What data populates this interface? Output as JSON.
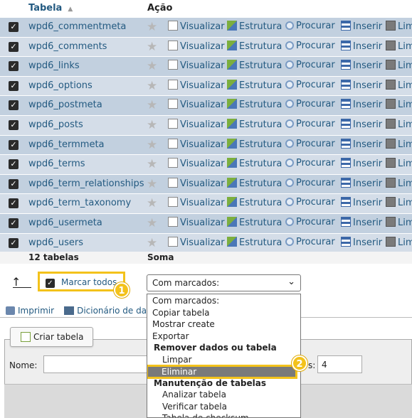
{
  "header": {
    "col_table": "Tabela",
    "sort_indicator": "▲",
    "col_action": "Ação"
  },
  "actions": {
    "view": "Visualizar",
    "structure": "Estrutura",
    "search": "Procurar",
    "insert": "Inserir",
    "empty": "Lim"
  },
  "tables": [
    "wpd6_commentmeta",
    "wpd6_comments",
    "wpd6_links",
    "wpd6_options",
    "wpd6_postmeta",
    "wpd6_posts",
    "wpd6_termmeta",
    "wpd6_terms",
    "wpd6_term_relationships",
    "wpd6_term_taxonomy",
    "wpd6_usermeta",
    "wpd6_users"
  ],
  "footer": {
    "count": "12 tabelas",
    "sum": "Soma"
  },
  "bulk": {
    "check_all": "Marcar todos",
    "select_value": "Com marcados:",
    "badge1": "1",
    "badge2": "2"
  },
  "dropdown": {
    "items": [
      {
        "label": "Com marcados:",
        "kind": "opt"
      },
      {
        "label": "Copiar tabela",
        "kind": "opt"
      },
      {
        "label": "Mostrar create",
        "kind": "opt"
      },
      {
        "label": "Exportar",
        "kind": "opt"
      },
      {
        "label": "Remover dados ou tabela",
        "kind": "grp"
      },
      {
        "label": "Limpar",
        "kind": "ind"
      },
      {
        "label": "Eliminar",
        "kind": "sel"
      },
      {
        "label": "Manutenção de tabelas",
        "kind": "grp"
      },
      {
        "label": "Analizar tabela",
        "kind": "ind"
      },
      {
        "label": "Verificar tabela",
        "kind": "ind"
      },
      {
        "label": "Tabela de checksum",
        "kind": "ind"
      }
    ]
  },
  "links": {
    "print": "Imprimir",
    "dictionary": "Dicionário de dad"
  },
  "create": {
    "button": "Criar tabela",
    "name_label": "Nome:",
    "cols_label": "s:",
    "cols_value": "4"
  },
  "colors": {
    "accent": "#f3c21b",
    "row": "#c2d0df",
    "link": "#235a81"
  }
}
